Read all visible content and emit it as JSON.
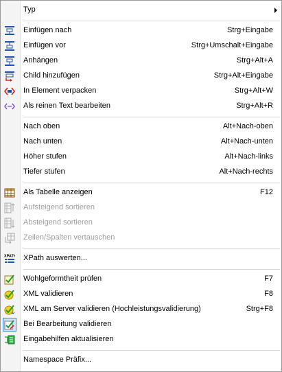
{
  "menu": {
    "items": [
      {
        "label": "Typ",
        "shortcut": "",
        "icon": "none",
        "has_submenu": true
      },
      {
        "label": "Einfügen nach",
        "shortcut": "Strg+Eingabe",
        "icon": "insert-after-icon"
      },
      {
        "label": "Einfügen vor",
        "shortcut": "Strg+Umschalt+Eingabe",
        "icon": "insert-before-icon"
      },
      {
        "label": "Anhängen",
        "shortcut": "Strg+Alt+A",
        "icon": "append-icon"
      },
      {
        "label": "Child hinzufügen",
        "shortcut": "Strg+Alt+Eingabe",
        "icon": "add-child-icon"
      },
      {
        "label": "In Element verpacken",
        "shortcut": "Strg+Alt+W",
        "icon": "wrap-in-element-icon"
      },
      {
        "label": "Als reinen Text bearbeiten",
        "shortcut": "Strg+Alt+R",
        "icon": "edit-as-text-icon"
      },
      {
        "label": "Nach oben",
        "shortcut": "Alt+Nach-oben",
        "icon": "none"
      },
      {
        "label": "Nach unten",
        "shortcut": "Alt+Nach-unten",
        "icon": "none"
      },
      {
        "label": "Höher stufen",
        "shortcut": "Alt+Nach-links",
        "icon": "none"
      },
      {
        "label": "Tiefer stufen",
        "shortcut": "Alt+Nach-rechts",
        "icon": "none"
      },
      {
        "label": "Als Tabelle anzeigen",
        "shortcut": "F12",
        "icon": "table-icon"
      },
      {
        "label": "Aufsteigend sortieren",
        "shortcut": "",
        "icon": "sort-ascending-icon",
        "disabled": true
      },
      {
        "label": "Absteigend sortieren",
        "shortcut": "",
        "icon": "sort-descending-icon",
        "disabled": true
      },
      {
        "label": "Zeilen/Spalten vertauschen",
        "shortcut": "",
        "icon": "swap-rows-columns-icon",
        "disabled": true
      },
      {
        "label": "XPath auswerten...",
        "shortcut": "",
        "icon": "xpath-icon"
      },
      {
        "label": "Wohlgeformtheit prüfen",
        "shortcut": "F7",
        "icon": "check-wellformed-icon"
      },
      {
        "label": "XML validieren",
        "shortcut": "F8",
        "icon": "validate-xml-icon"
      },
      {
        "label": "XML am Server validieren (Hochleistungsvalidierung)",
        "shortcut": "Strg+F8",
        "icon": "validate-server-icon"
      },
      {
        "label": "Bei Bearbeitung validieren",
        "shortcut": "",
        "icon": "validate-on-edit-icon",
        "checked": true
      },
      {
        "label": "Eingabehilfen aktualisieren",
        "shortcut": "",
        "icon": "refresh-entry-helpers-icon"
      },
      {
        "label": "Namespace Präfix...",
        "shortcut": "",
        "icon": "none"
      }
    ]
  },
  "colors": {
    "icon_blue": "#1f4fb8",
    "icon_red": "#cc1f1f",
    "icon_purple": "#7a3fcf",
    "check_green": "#1e9e2e",
    "check_yellow": "#f2d21a",
    "disabled_text": "#9d9d9d"
  }
}
